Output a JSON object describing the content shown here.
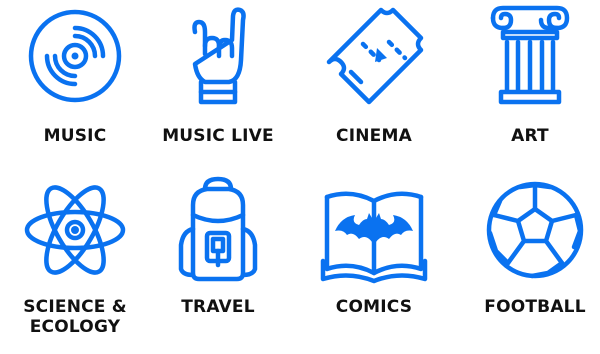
{
  "colors": {
    "icon": "#0a72f0",
    "label": "#111111",
    "background": "#ffffff"
  },
  "categories": [
    {
      "label": "MUSIC",
      "icon": "vinyl-record-icon"
    },
    {
      "label": "MUSIC LIVE",
      "icon": "rock-hand-icon"
    },
    {
      "label": "CINEMA",
      "icon": "movie-ticket-icon"
    },
    {
      "label": "ART",
      "icon": "greek-column-icon"
    },
    {
      "label": "SCIENCE &\nECOLOGY",
      "icon": "atom-icon"
    },
    {
      "label": "TRAVEL",
      "icon": "backpack-icon"
    },
    {
      "label": "COMICS",
      "icon": "bat-book-icon"
    },
    {
      "label": "FOOTBALL",
      "icon": "soccer-ball-icon"
    }
  ]
}
